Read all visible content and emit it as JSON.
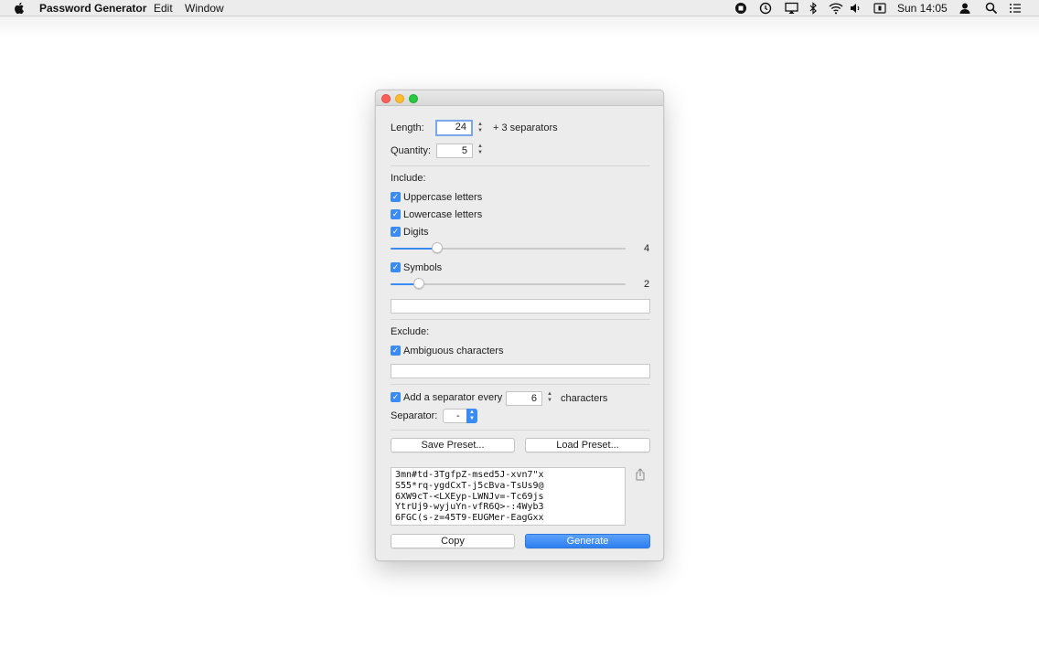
{
  "menubar": {
    "app_name": "Password Generator",
    "menus": [
      "Edit",
      "Window"
    ],
    "clock": "Sun 14:05",
    "status_icons": [
      "screen-recording-icon",
      "time-machine-icon",
      "airplay-icon",
      "bluetooth-icon",
      "wifi-icon",
      "volume-icon",
      "input-menu-icon",
      "user-icon",
      "spotlight-search-icon",
      "notification-center-icon"
    ]
  },
  "window": {
    "length": {
      "label": "Length:",
      "value": "24",
      "suffix": "+ 3 separators"
    },
    "quantity": {
      "label": "Quantity:",
      "value": "5"
    },
    "include": {
      "heading": "Include:",
      "uppercase": {
        "label": "Uppercase letters",
        "checked": true
      },
      "lowercase": {
        "label": "Lowercase letters",
        "checked": true
      },
      "digits": {
        "label": "Digits",
        "checked": true,
        "slider_value": "4",
        "slider_fraction": 0.2
      },
      "symbols": {
        "label": "Symbols",
        "checked": true,
        "slider_value": "2",
        "slider_fraction": 0.12
      },
      "custom_field_value": ""
    },
    "exclude": {
      "heading": "Exclude:",
      "ambiguous": {
        "label": "Ambiguous characters",
        "checked": true
      },
      "custom_field_value": ""
    },
    "separator": {
      "checkbox_label": "Add a separator every",
      "every_value": "6",
      "every_suffix": "characters",
      "label": "Separator:",
      "value": "-"
    },
    "buttons": {
      "save_preset": "Save Preset...",
      "load_preset": "Load Preset...",
      "copy": "Copy",
      "generate": "Generate"
    },
    "output_lines": [
      "3mn#td-3TgfpZ-msed5J-xvn7\"x",
      "S55*rq-ygdCxT-j5cBva-TsUs9@",
      "6XW9cT-<LXEyp-LWNJv=-Tc69js",
      "YtrUj9-wyjuYn-vfR6Q>-:4Wyb3",
      "6FGC(s-z=45T9-EUGMer-EagGxx"
    ]
  },
  "colors": {
    "accent": "#3a8bf6",
    "close": "#ff5f57",
    "minimize": "#febc2e",
    "zoom": "#28c840"
  }
}
